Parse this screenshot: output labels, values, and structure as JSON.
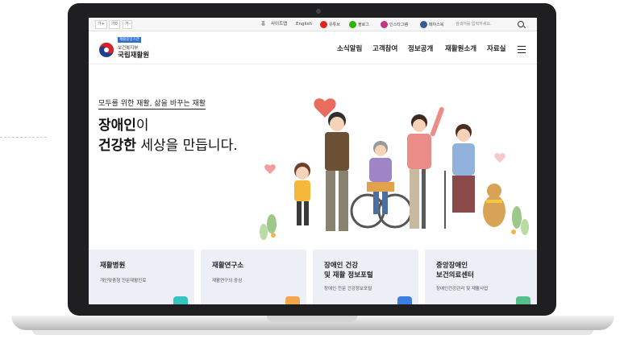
{
  "utility_bar": {
    "font_sizes": [
      "가+",
      "가0",
      "가-"
    ],
    "links": [
      "홈",
      "사이트맵",
      "English"
    ],
    "sns": [
      {
        "label": "유튜브",
        "color": "#e62117"
      },
      {
        "label": "블로그",
        "color": "#2db400"
      },
      {
        "label": "인스타그램",
        "color": "#c13584"
      },
      {
        "label": "페이스북",
        "color": "#3b5998"
      }
    ],
    "search_placeholder": "검색어를 입력하세요."
  },
  "header": {
    "logo_badge": "재활중앙기관",
    "logo_org": "보건복지부",
    "logo_name": "국립재활원",
    "nav": [
      "소식알림",
      "고객참여",
      "정보공개",
      "재활원소개",
      "자료실"
    ]
  },
  "hero": {
    "subtitle": "모두를 위한 재활, 삶을 바꾸는 재활",
    "line1_bold": "장애인",
    "line1_rest": "이",
    "line2_bold": "건강한",
    "line2_rest": " 세상을 만듭니다."
  },
  "cards": [
    {
      "title": "재활병원",
      "desc": "개인맞춤형 전문재활진료",
      "accent": "#37c4c0"
    },
    {
      "title": "재활연구소",
      "desc": "재활연구의 중심",
      "accent": "#f3a64b"
    },
    {
      "title": "장애인 건강\n및 재활 정보포털",
      "desc": "장애인 전문 건강정보포털",
      "accent": "#3d7fe0"
    },
    {
      "title": "중앙장애인\n보건의료센터",
      "desc": "장애인건강관리 및 재활사업",
      "accent": "#56c08b"
    }
  ],
  "colors": {
    "laptop_bezel": "#1f1f22",
    "card_bg": "#eceff5"
  }
}
